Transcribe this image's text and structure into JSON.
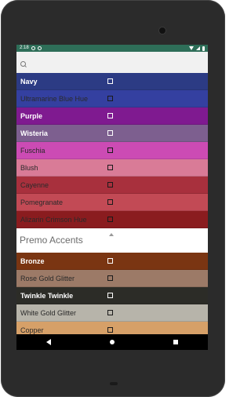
{
  "status_bar": {
    "time": "2:18"
  },
  "search": {
    "placeholder": ""
  },
  "colors_top": [
    {
      "name": "Navy",
      "bg": "#2c3b84",
      "style": "bold"
    },
    {
      "name": "Ultramarine Blue Hue",
      "bg": "#3440a0",
      "style": "light"
    },
    {
      "name": "Purple",
      "bg": "#7f1a90",
      "style": "bold"
    },
    {
      "name": "Wisteria",
      "bg": "#7d5f8f",
      "style": "bold"
    },
    {
      "name": "Fuschia",
      "bg": "#cc4bb4",
      "style": "light"
    },
    {
      "name": "Blush",
      "bg": "#d97b97",
      "style": "light"
    },
    {
      "name": "Cayenne",
      "bg": "#a8303d",
      "style": "light"
    },
    {
      "name": "Pomegranate",
      "bg": "#c24a55",
      "style": "light"
    },
    {
      "name": "Alizarin Crimson Hue",
      "bg": "#8a1c1f",
      "style": "light"
    }
  ],
  "section": {
    "title": "Premo Accents"
  },
  "colors_bottom": [
    {
      "name": "Bronze",
      "bg": "#7a3512",
      "style": "bold"
    },
    {
      "name": "Rose Gold Glitter",
      "bg": "#9c7a67",
      "style": "light"
    },
    {
      "name": "Twinkle Twinkle",
      "bg": "#2c2c27",
      "style": "bold"
    },
    {
      "name": "White Gold Glitter",
      "bg": "#b7b4aa",
      "style": "light"
    },
    {
      "name": "Copper",
      "bg": "#d6a068",
      "style": "light"
    }
  ]
}
